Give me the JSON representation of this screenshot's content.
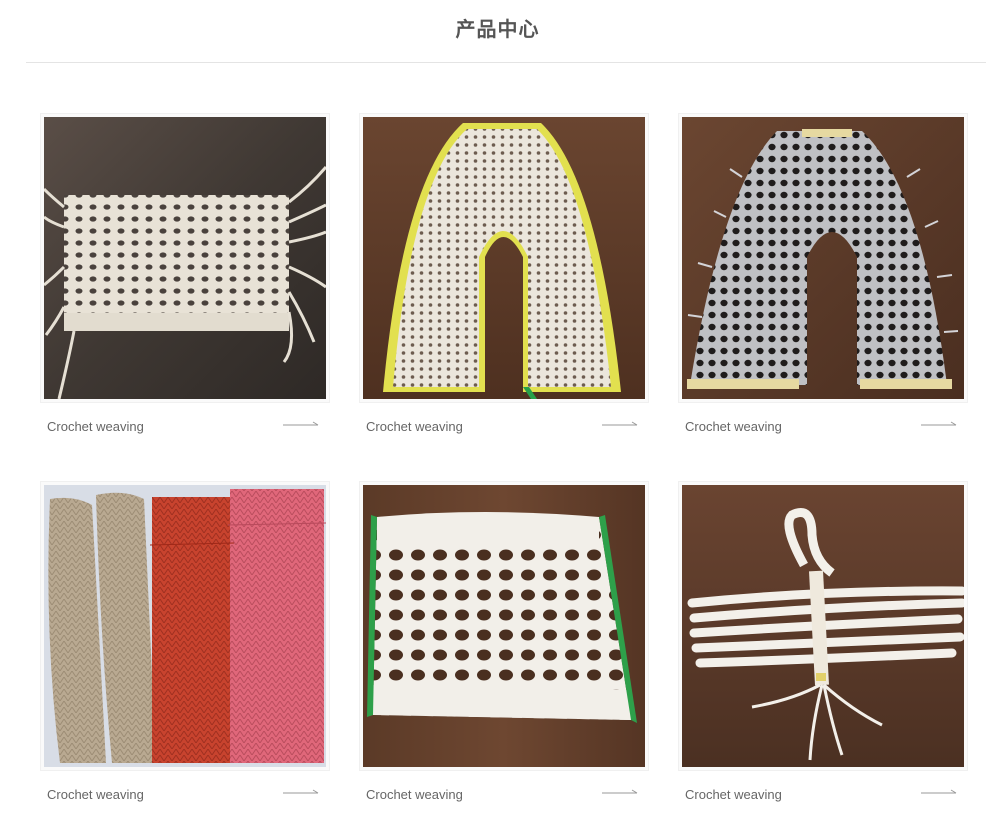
{
  "page": {
    "title": "产品中心"
  },
  "products": [
    {
      "caption": "Crochet weaving",
      "image": "white-macrame-rectangle"
    },
    {
      "caption": "Crochet weaving",
      "image": "white-macrame-shoe-upper"
    },
    {
      "caption": "Crochet weaving",
      "image": "metallic-mesh-shoe-upper"
    },
    {
      "caption": "Crochet weaving",
      "image": "colored-knit-strips"
    },
    {
      "caption": "Crochet weaving",
      "image": "white-macrame-green-edge"
    },
    {
      "caption": "Crochet weaving",
      "image": "white-cord-strap"
    }
  ]
}
